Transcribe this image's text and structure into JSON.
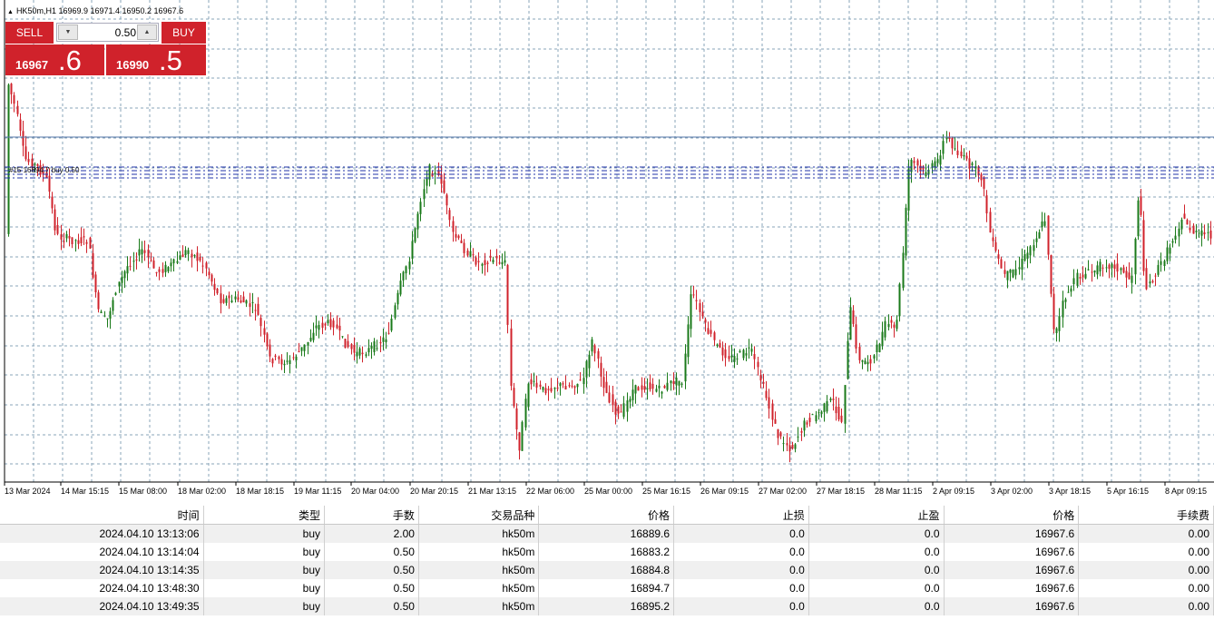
{
  "chart": {
    "title": "HK50m,H1  16969.9 16971.4 16950.2 16967.6",
    "bid_line_label": "#15 16894.7 buy 0.50",
    "x_labels": [
      "13 Mar 2024",
      "14 Mar 15:15",
      "15 Mar 08:00",
      "18 Mar 02:00",
      "18 Mar 18:15",
      "19 Mar 11:15",
      "20 Mar 04:00",
      "20 Mar 20:15",
      "21 Mar 13:15",
      "22 Mar 06:00",
      "25 Mar 00:00",
      "25 Mar 16:15",
      "26 Mar 09:15",
      "27 Mar 02:00",
      "27 Mar 18:15",
      "28 Mar 11:15",
      "2 Apr 09:15",
      "3 Apr 02:00",
      "3 Apr 18:15",
      "5 Apr 16:15",
      "8 Apr 09:15"
    ],
    "colors": {
      "bull": "#1a7a1a",
      "bear": "#d0222b",
      "grid": "#8aa4b8",
      "order_line": "#2233aa",
      "price_line": "#5577aa"
    }
  },
  "trade_panel": {
    "sell_label": "SELL",
    "buy_label": "BUY",
    "lot": "0.50",
    "sell_price_small": "16967",
    "sell_price_big": ".6",
    "buy_price_small": "16990",
    "buy_price_big": ".5",
    "down_arrow": "▼",
    "up_arrow": "▲"
  },
  "table": {
    "headers": [
      "时间",
      "类型",
      "手数",
      "交易品种",
      "价格",
      "止损",
      "止盈",
      "价格",
      "手续费"
    ],
    "rows": [
      [
        "2024.04.10 13:13:06",
        "buy",
        "2.00",
        "hk50m",
        "16889.6",
        "0.0",
        "0.0",
        "16967.6",
        "0.00"
      ],
      [
        "2024.04.10 13:14:04",
        "buy",
        "0.50",
        "hk50m",
        "16883.2",
        "0.0",
        "0.0",
        "16967.6",
        "0.00"
      ],
      [
        "2024.04.10 13:14:35",
        "buy",
        "0.50",
        "hk50m",
        "16884.8",
        "0.0",
        "0.0",
        "16967.6",
        "0.00"
      ],
      [
        "2024.04.10 13:48:30",
        "buy",
        "0.50",
        "hk50m",
        "16894.7",
        "0.0",
        "0.0",
        "16967.6",
        "0.00"
      ],
      [
        "2024.04.10 13:49:35",
        "buy",
        "0.50",
        "hk50m",
        "16895.2",
        "0.0",
        "0.0",
        "16967.6",
        "0.00"
      ]
    ]
  }
}
